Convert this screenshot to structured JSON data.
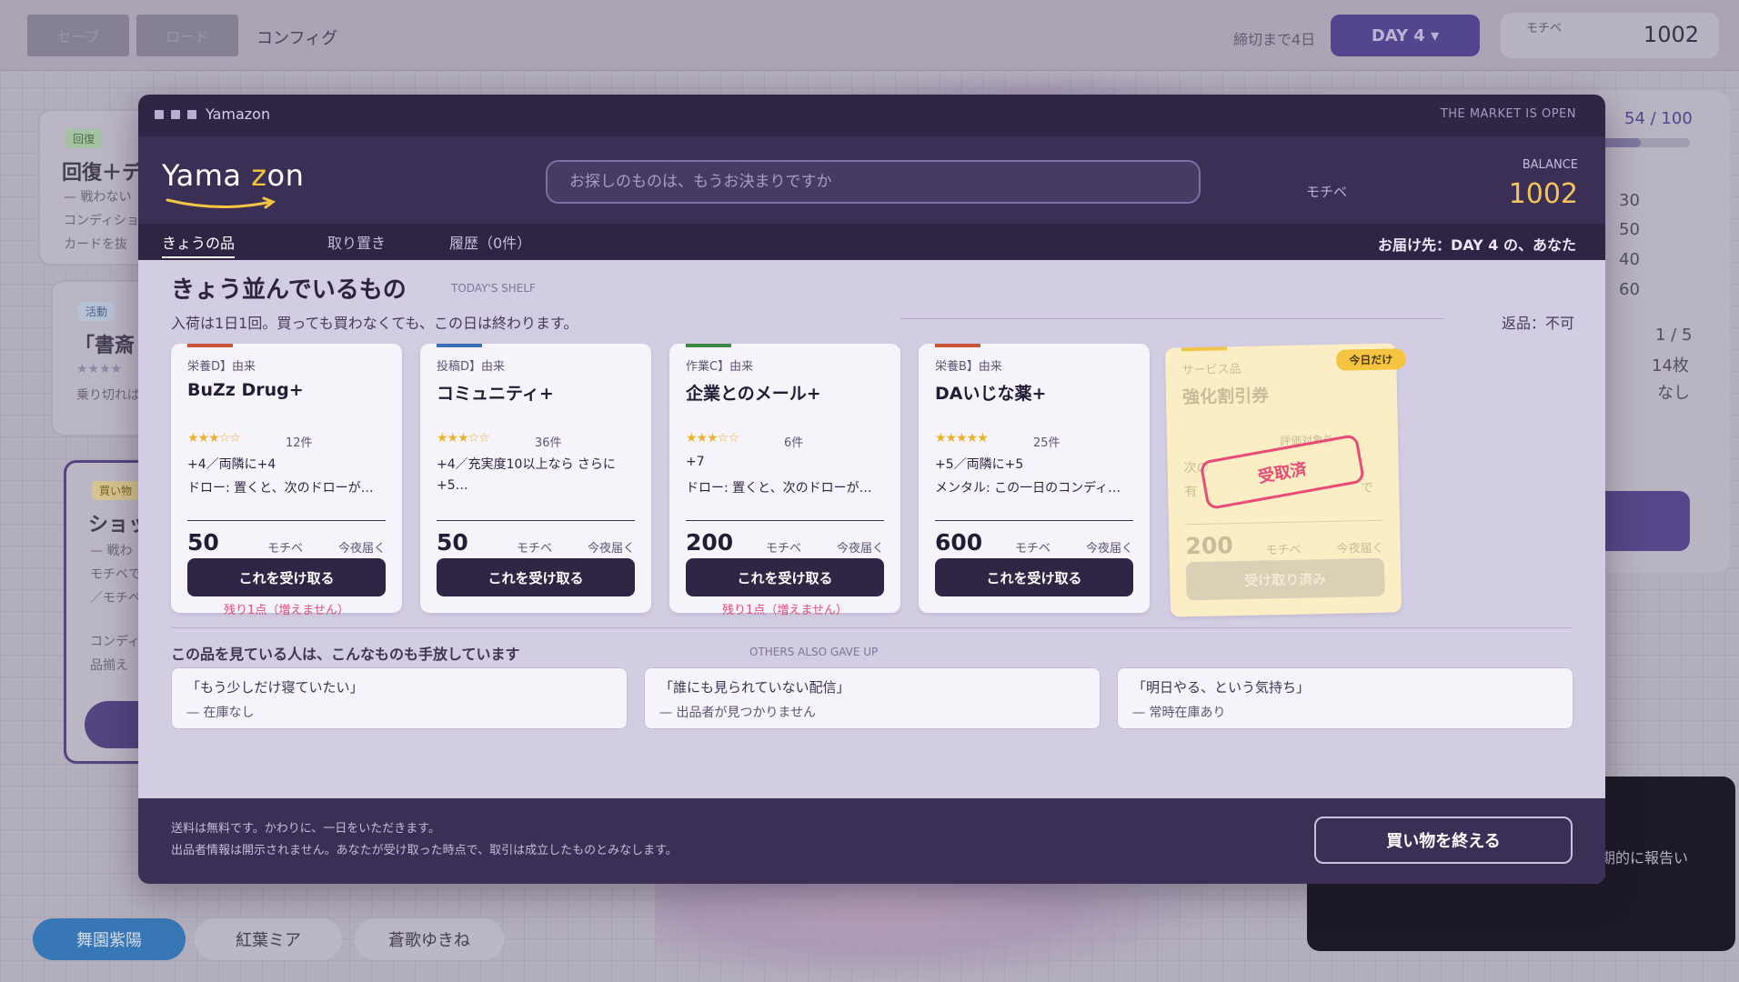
{
  "background": {
    "topbar": {
      "save_label": "セーブ",
      "load_label": "ロード",
      "config_label": "コンフィグ",
      "deadline": "締切まで4日",
      "day_selector": "DAY 4 ▾",
      "currency_label": "モチベ",
      "currency_value": "1002"
    },
    "cards": [
      {
        "tag": "回復",
        "title": "回復＋デ",
        "lines": [
          "— 戦わない",
          "コンディショ",
          "カードを抜"
        ]
      },
      {
        "tag": "活動",
        "title": "「書斎",
        "lines": [
          "★★★★",
          "乗り切れば"
        ]
      },
      {
        "tag": "買い物",
        "title": "ショッ",
        "lines": [
          "— 戦わ",
          "モチベで",
          "／モチベ",
          "コンディ",
          "品揃え"
        ]
      }
    ],
    "side_panel": {
      "progress": "54 / 100",
      "progress_fraction": 0.54,
      "stats": [
        "30",
        "50",
        "40",
        "60"
      ],
      "info": [
        "1 / 5",
        "14枚",
        "なし"
      ]
    },
    "chat_text": "期的に報告い",
    "characters": [
      "舞園紫陽",
      "紅葉ミア",
      "蒼歌ゆきね"
    ]
  },
  "modal": {
    "window_title": "Yamazon",
    "window_status": "THE MARKET IS OPEN",
    "logo": {
      "part1": "Yama ",
      "accent": "z",
      "part2": "on"
    },
    "search_placeholder": "お探しのものは、もうお決まりですか",
    "currency_label": "モチベ",
    "balance_label": "BALANCE",
    "balance_value": "1002",
    "tabs": [
      {
        "label": "きょうの品",
        "active": true
      },
      {
        "label": "取り置き",
        "active": false
      },
      {
        "label": "履歴（0件）",
        "active": false
      }
    ],
    "delivery": "お届け先：DAY 4 の、あなた",
    "shelf": {
      "title": "きょう並んでいるもの",
      "title_en": "TODAY'S SHELF",
      "subtitle": "入荷は1日1回。買っても買わなくても、この日は終わります。",
      "return_policy": "返品：不可"
    },
    "products": [
      {
        "origin": "栄養D】由来",
        "name": "BuZz Drug+",
        "stars": "★★★☆☆",
        "rating": 3,
        "reviews": "12件",
        "effect1": "+4／両隣に+4",
        "effect2": "ドロー: 置くと、次のドローが…",
        "price": "50",
        "currency": "モチベ",
        "shipping": "今夜届く",
        "button": "これを受け取る",
        "stock": "残り1点（増えません）",
        "stripe": "#c8553a"
      },
      {
        "origin": "投稿D】由来",
        "name": "コミュニティ+",
        "stars": "★★★☆☆",
        "rating": 3,
        "reviews": "36件",
        "effect1": "+4／充実度10以上なら さらに",
        "effect2": "+5…",
        "price": "50",
        "currency": "モチベ",
        "shipping": "今夜届く",
        "button": "これを受け取る",
        "stock": "",
        "stripe": "#3b6fb5"
      },
      {
        "origin": "作業C】由来",
        "name": "企業とのメール+",
        "stars": "★★★☆☆",
        "rating": 3,
        "reviews": "6件",
        "effect1": "+7",
        "effect2": "ドロー: 置くと、次のドローが…",
        "price": "200",
        "currency": "モチベ",
        "shipping": "今夜届く",
        "button": "これを受け取る",
        "stock": "残り1点（増えません）",
        "stripe": "#3a8a46"
      },
      {
        "origin": "栄養B】由来",
        "name": "DAいじな薬+",
        "stars": "★★★★★",
        "rating": 5,
        "reviews": "25件",
        "effect1": "+5／両隣に+5",
        "effect2": "メンタル: この一日のコンディ…",
        "price": "600",
        "currency": "モチベ",
        "shipping": "今夜届く",
        "button": "これを受け取る",
        "stock": "",
        "stripe": "#c8553a"
      }
    ],
    "special": {
      "origin": "サービス品",
      "name": "強化割引券",
      "badge": "今日だけ",
      "excluded": "評価対象外",
      "effect1": "次の",
      "effect2": "有",
      "effect3": "で",
      "stamp": "受取済",
      "price": "200",
      "currency": "モチベ",
      "shipping": "今夜届く",
      "button": "受け取り済み",
      "stripe": "#f0c64a"
    },
    "others": {
      "title": "この品を見ている人は、こんなものも手放しています",
      "title_en": "OTHERS ALSO GAVE UP",
      "items": [
        {
          "quote": "「もう少しだけ寝ていたい」",
          "note": "— 在庫なし"
        },
        {
          "quote": "「誰にも見られていない配信」",
          "note": "— 出品者が見つかりません"
        },
        {
          "quote": "「明日やる、という気持ち」",
          "note": "— 常時在庫あり"
        }
      ]
    },
    "footer": {
      "line1": "送料は無料です。かわりに、一日をいただきます。",
      "line2": "出品者情報は開示されません。あなたが受け取った時点で、取引は成立したものとみなします。",
      "end_button": "買い物を終える"
    }
  }
}
